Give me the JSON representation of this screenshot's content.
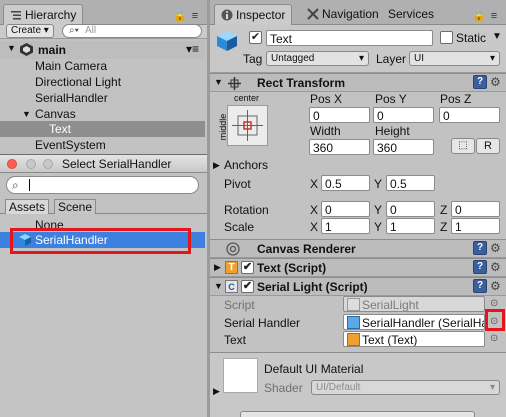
{
  "hierarchy": {
    "tab_label": "Hierarchy",
    "create_label": "Create ▾",
    "search_placeholder": "All",
    "scene_name": "main",
    "items": [
      "Main Camera",
      "Directional Light",
      "SerialHandler",
      "Canvas",
      "Text",
      "EventSystem"
    ],
    "selected_item": "Text"
  },
  "selector": {
    "title": "Select SerialHandler",
    "search_value": "",
    "tabs": [
      "Assets",
      "Scene"
    ],
    "items": [
      "None",
      "SerialHandler"
    ],
    "selected_item": "SerialHandler"
  },
  "inspector": {
    "tabs": [
      "Inspector",
      "Navigation",
      "Services"
    ],
    "object_name": "Text",
    "static_label": "Static",
    "tag_label": "Tag",
    "tag_value": "Untagged",
    "layer_label": "Layer",
    "layer_value": "UI",
    "rect_transform": {
      "title": "Rect Transform",
      "anchor_h": "center",
      "anchor_v": "middle",
      "pos_x_label": "Pos X",
      "pos_y_label": "Pos Y",
      "pos_z_label": "Pos Z",
      "pos_x": "0",
      "pos_y": "0",
      "pos_z": "0",
      "width_label": "Width",
      "height_label": "Height",
      "width": "360",
      "height": "360",
      "r_button": "R",
      "anchors_label": "Anchors",
      "pivot_label": "Pivot",
      "pivot_x": "0.5",
      "pivot_y": "0.5",
      "rotation_label": "Rotation",
      "rot_x": "0",
      "rot_y": "0",
      "rot_z": "0",
      "scale_label": "Scale",
      "scale_x": "1",
      "scale_y": "1",
      "scale_z": "1",
      "x": "X",
      "y": "Y",
      "z": "Z"
    },
    "canvas_renderer_title": "Canvas Renderer",
    "text_script_title": "Text (Script)",
    "serial_light": {
      "title": "Serial Light (Script)",
      "script_label": "Script",
      "script_value": "SerialLight",
      "serial_handler_label": "Serial Handler",
      "serial_handler_value": "SerialHandler (SerialHan",
      "text_label": "Text",
      "text_value": "Text (Text)"
    },
    "material": {
      "name": "Default UI Material",
      "shader_label": "Shader",
      "shader_value": "UI/Default"
    }
  },
  "colors": {
    "highlight_blue": "#3d80df",
    "annotation_red": "#e5161b"
  }
}
